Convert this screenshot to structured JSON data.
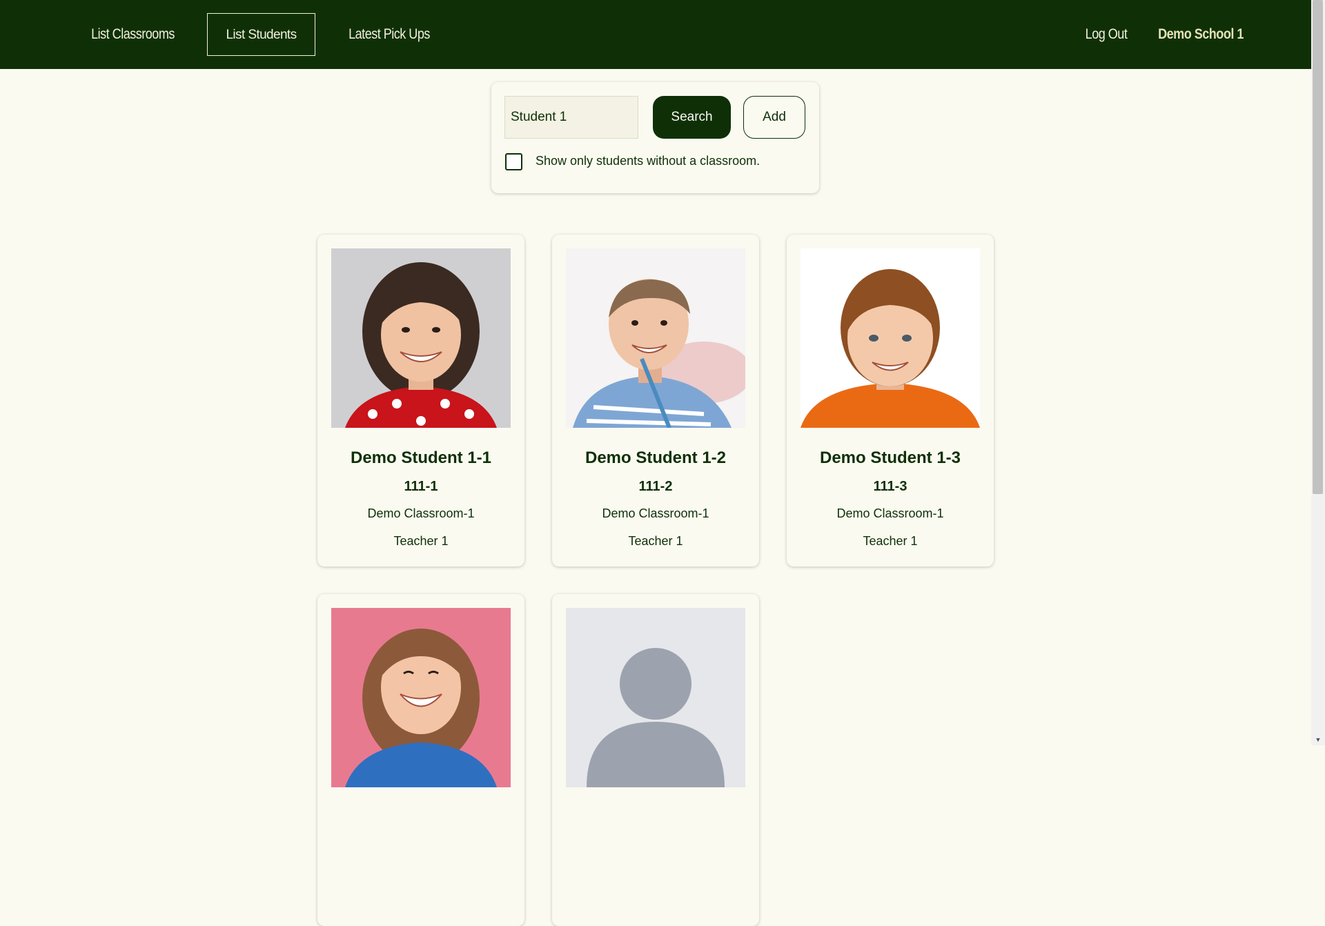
{
  "nav": {
    "list_classrooms": "List Classrooms",
    "list_students": "List Students",
    "latest_pickups": "Latest Pick Ups",
    "logout": "Log Out",
    "school_name": "Demo School 1"
  },
  "search": {
    "input_value": "Student 1",
    "search_button": "Search",
    "add_button": "Add",
    "filter_label": "Show only students without a classroom.",
    "filter_checked": false
  },
  "students": [
    {
      "name": "Demo Student 1-1",
      "id": "111-1",
      "classroom": "Demo Classroom-1",
      "teacher": "Teacher 1"
    },
    {
      "name": "Demo Student 1-2",
      "id": "111-2",
      "classroom": "Demo Classroom-1",
      "teacher": "Teacher 1"
    },
    {
      "name": "Demo Student 1-3",
      "id": "111-3",
      "classroom": "Demo Classroom-1",
      "teacher": "Teacher 1"
    },
    {
      "name": "",
      "id": "",
      "classroom": "",
      "teacher": ""
    },
    {
      "name": "",
      "id": "",
      "classroom": "",
      "teacher": ""
    }
  ],
  "colors": {
    "primary": "#0f3006",
    "background": "#fafaf1",
    "nav_text": "#f1f0dc"
  }
}
